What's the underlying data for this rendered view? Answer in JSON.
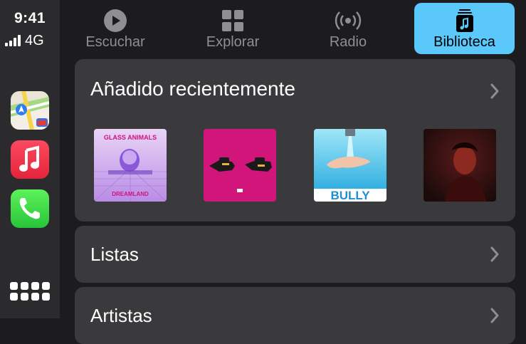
{
  "status": {
    "time": "9:41",
    "network": "4G"
  },
  "rail": {
    "apps": [
      "maps-icon",
      "music-icon",
      "phone-icon"
    ],
    "home_icon": "app-grid-icon"
  },
  "tabs": [
    {
      "label": "Escuchar",
      "icon": "play-circle-icon",
      "selected": false
    },
    {
      "label": "Explorar",
      "icon": "grid-icon",
      "selected": false
    },
    {
      "label": "Radio",
      "icon": "broadcast-icon",
      "selected": false
    },
    {
      "label": "Biblioteca",
      "icon": "music-library-icon",
      "selected": true
    }
  ],
  "library": {
    "recent": {
      "title": "Añadido recientemente",
      "albums": [
        {
          "name": "album-dreamland",
          "cover_text": "GLASS ANIMALS",
          "cover_sub": "DREAMLAND"
        },
        {
          "name": "album-run-the-jewels",
          "cover_text": "",
          "cover_sub": ""
        },
        {
          "name": "album-bully",
          "cover_text": "BULLY",
          "cover_sub": ""
        },
        {
          "name": "album-portrait",
          "cover_text": "",
          "cover_sub": ""
        }
      ]
    },
    "rows": [
      {
        "label": "Listas"
      },
      {
        "label": "Artistas"
      }
    ]
  },
  "colors": {
    "accent": "#5ac8fa",
    "background": "#1c1c1e",
    "card": "#3a3a3c",
    "inactive": "#8e8e93"
  }
}
